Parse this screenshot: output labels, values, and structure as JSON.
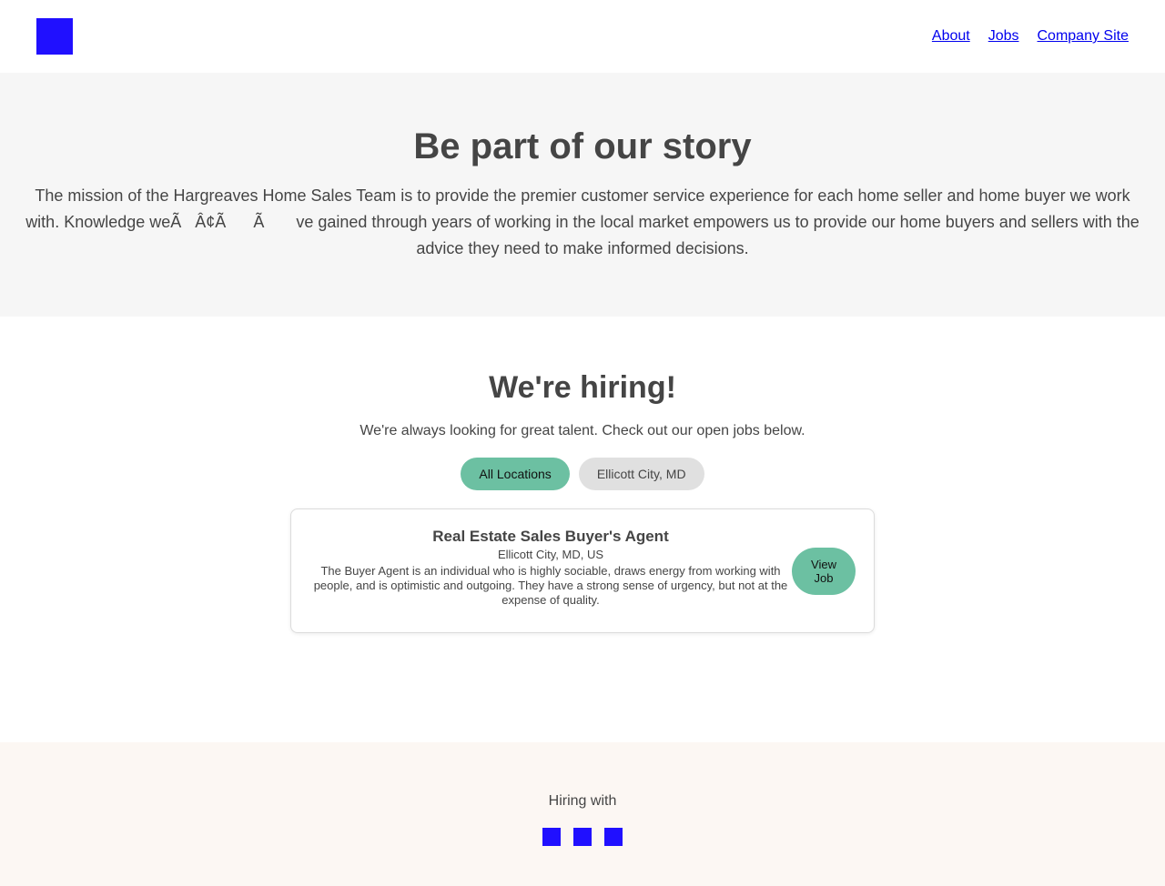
{
  "nav": {
    "about": "About",
    "jobs": "Jobs",
    "company_site": "Company Site"
  },
  "hero": {
    "title": "Be part of our story",
    "description": "The mission of the Hargreaves Home Sales Team is to provide the premier customer service experience for each home seller and home buyer we work with. Knowledge weÃ   Â¢Ã      Ã       ve gained through years of working in the local market empowers us to provide our home buyers and sellers with the advice they need to make informed decisions."
  },
  "hiring": {
    "title": "We're hiring!",
    "subtitle": "We're always looking for great talent. Check out our open jobs below.",
    "filters": [
      {
        "label": "All Locations",
        "active": true
      },
      {
        "label": "Ellicott City, MD",
        "active": false
      }
    ],
    "jobs": [
      {
        "title": "Real Estate Sales Buyer's Agent",
        "location": "Ellicott City, MD, US",
        "description": "The Buyer Agent is an individual who is highly sociable, draws energy from working with people, and is optimistic and outgoing. They have a strong sense of urgency, but not at the expense of quality.",
        "button": "View Job"
      }
    ]
  },
  "footer": {
    "hiring_with": "Hiring with",
    "social_icons": [
      "social-icon-1",
      "social-icon-2",
      "social-icon-3"
    ]
  },
  "colors": {
    "logo": "#2010ff",
    "accent": "#6cc0a2",
    "hero_bg": "#f6f6f6",
    "footer_bg": "#fcf7f3",
    "text": "#454545"
  }
}
